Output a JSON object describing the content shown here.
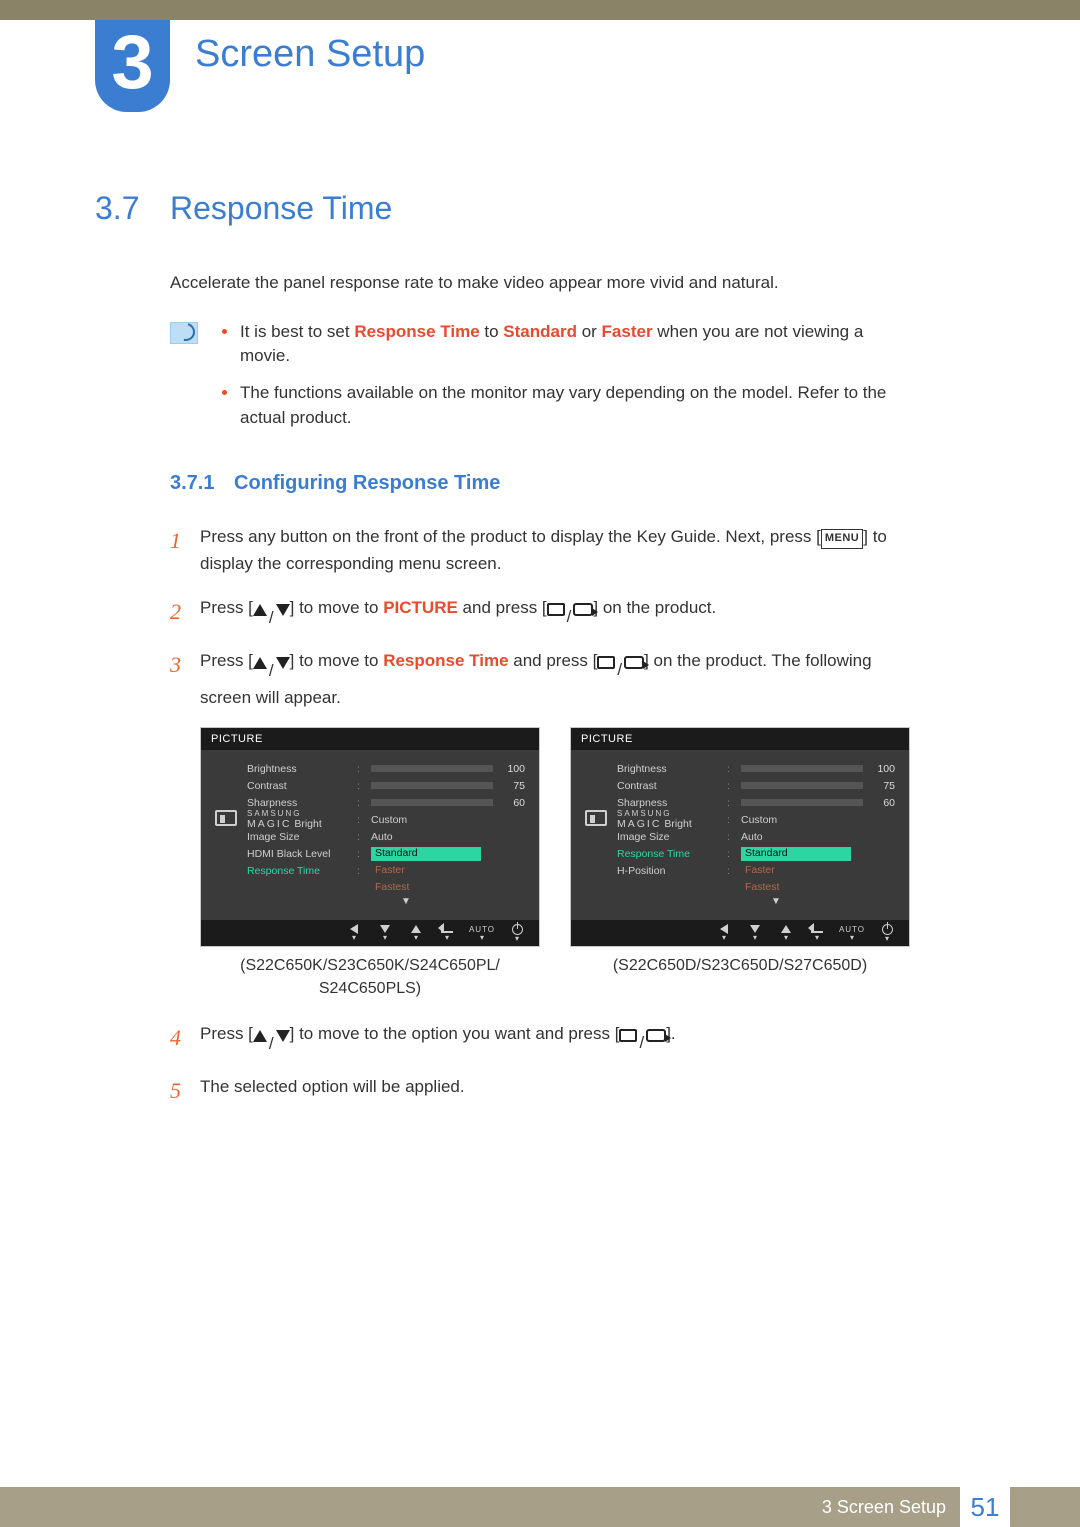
{
  "chapter": {
    "number": "3",
    "title": "Screen Setup"
  },
  "section": {
    "number": "3.7",
    "title": "Response Time"
  },
  "intro": "Accelerate the panel response rate to make video appear more vivid and natural.",
  "notes": {
    "n1_a": "It is best to set ",
    "n1_b": "Response Time",
    "n1_c": " to ",
    "n1_d": "Standard",
    "n1_e": " or ",
    "n1_f": "Faster",
    "n1_g": " when you are not viewing a movie.",
    "n2": "The functions available on the monitor may vary depending on the model. Refer to the actual product."
  },
  "subsection": {
    "number": "3.7.1",
    "title": "Configuring Response Time"
  },
  "steps": {
    "s1a": "Press any button on the front of the product to display the Key Guide. Next, press [",
    "s1b": "MENU",
    "s1c": "] to display the corresponding menu screen.",
    "s2a": "Press [",
    "s2b": "] to move to ",
    "s2c": "PICTURE",
    "s2d": " and press [",
    "s2e": "] on the product.",
    "s3a": "Press [",
    "s3b": "] to move to ",
    "s3c": "Response Time",
    "s3d": " and press [",
    "s3e": "] on the product. The following screen will appear.",
    "s4a": "Press [",
    "s4b": "] to move to the option you want and press [",
    "s4c": "].",
    "s5": "The selected option will be applied."
  },
  "osd": {
    "title": "PICTURE",
    "brightness": {
      "label": "Brightness",
      "value": "100",
      "pct": 100
    },
    "contrast": {
      "label": "Contrast",
      "value": "75",
      "pct": 75
    },
    "sharpness": {
      "label": "Sharpness",
      "value": "60",
      "pct": 60
    },
    "magic1": "SAMSUNG",
    "magic2": " Bright",
    "magic_val": "Custom",
    "imagesize": {
      "label": "Image Size",
      "value": "Auto"
    },
    "hdmi": "HDMI Black Level",
    "response": "Response Time",
    "hpos": "H-Position",
    "opts": {
      "standard": "Standard",
      "faster": "Faster",
      "fastest": "Fastest"
    },
    "auto": "AUTO"
  },
  "captions": {
    "left": "(S22C650K/S23C650K/S24C650PL/ S24C650PLS)",
    "right": "(S22C650D/S23C650D/S27C650D)"
  },
  "footer": {
    "chapter": "3 Screen Setup",
    "page": "51"
  }
}
